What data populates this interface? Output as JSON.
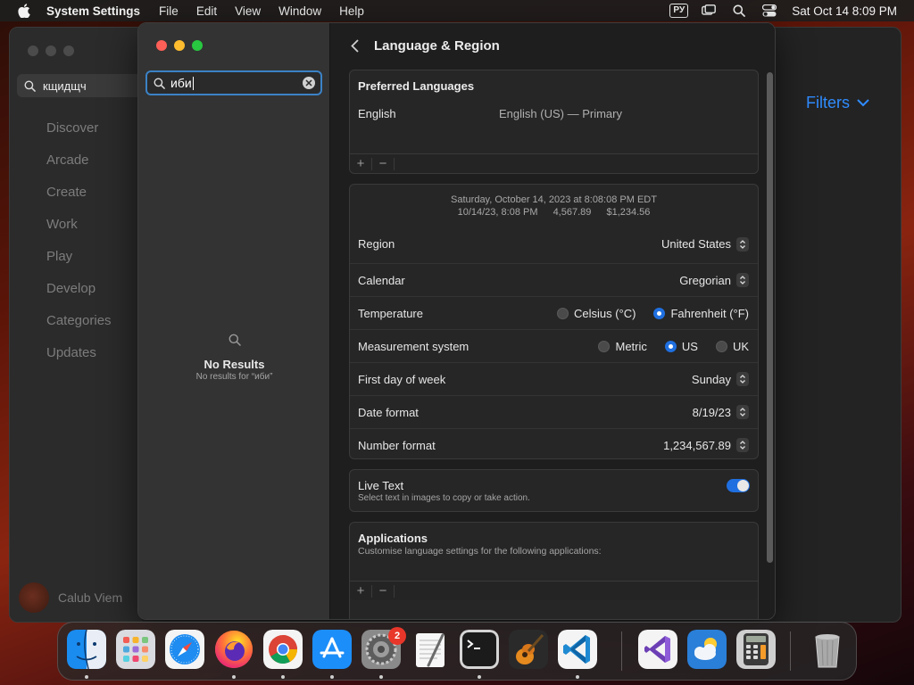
{
  "menubar": {
    "app_name": "System Settings",
    "menus": [
      "File",
      "Edit",
      "View",
      "Window",
      "Help"
    ],
    "input_source": "РУ",
    "clock": "Sat Oct 14  8:09 PM"
  },
  "background_window": {
    "search_value": "кщидщч",
    "nav": [
      "Discover",
      "Arcade",
      "Create",
      "Work",
      "Play",
      "Develop",
      "Categories",
      "Updates"
    ],
    "user_name": "Calub Viem",
    "filters_label": "Filters"
  },
  "settings": {
    "sidebar": {
      "search_value": "иби",
      "no_results_title": "No Results",
      "no_results_sub": "No results for “иби”"
    },
    "header_title": "Language & Region",
    "preferred_languages": {
      "title": "Preferred Languages",
      "language": "English",
      "description": "English (US) — Primary",
      "add": "+",
      "remove": "−"
    },
    "preview": {
      "line1": "Saturday, October 14, 2023 at 8:08:08 PM EDT",
      "short_date": "10/14/23, 8:08 PM",
      "number": "4,567.89",
      "currency": "$1,234.56"
    },
    "rows": {
      "region": {
        "label": "Region",
        "value": "United States"
      },
      "calendar": {
        "label": "Calendar",
        "value": "Gregorian"
      },
      "temperature": {
        "label": "Temperature",
        "options": [
          "Celsius (°C)",
          "Fahrenheit (°F)"
        ],
        "selected": "Fahrenheit (°F)"
      },
      "measurement": {
        "label": "Measurement system",
        "options": [
          "Metric",
          "US",
          "UK"
        ],
        "selected": "US"
      },
      "first_day": {
        "label": "First day of week",
        "value": "Sunday"
      },
      "date_format": {
        "label": "Date format",
        "value": "8/19/23"
      },
      "number_format": {
        "label": "Number format",
        "value": "1,234,567.89"
      }
    },
    "live_text": {
      "title": "Live Text",
      "subtitle": "Select text in images to copy or take action.",
      "enabled": true
    },
    "applications": {
      "title": "Applications",
      "subtitle": "Customise language settings for the following applications:",
      "add": "+",
      "remove": "−"
    }
  },
  "dock": {
    "apps": [
      "Finder",
      "Launchpad",
      "Safari",
      "Firefox",
      "Chrome",
      "App Store",
      "System Settings",
      "TextEdit",
      "Terminal",
      "GarageBand",
      "Visual Studio Code",
      "Visual Studio",
      "Weather",
      "Calculator",
      "Trash"
    ],
    "settings_badge": "2"
  },
  "colors": {
    "accent": "#1f6fe0",
    "search_focus": "#3b82c6",
    "filters_blue": "#2f8cff"
  }
}
